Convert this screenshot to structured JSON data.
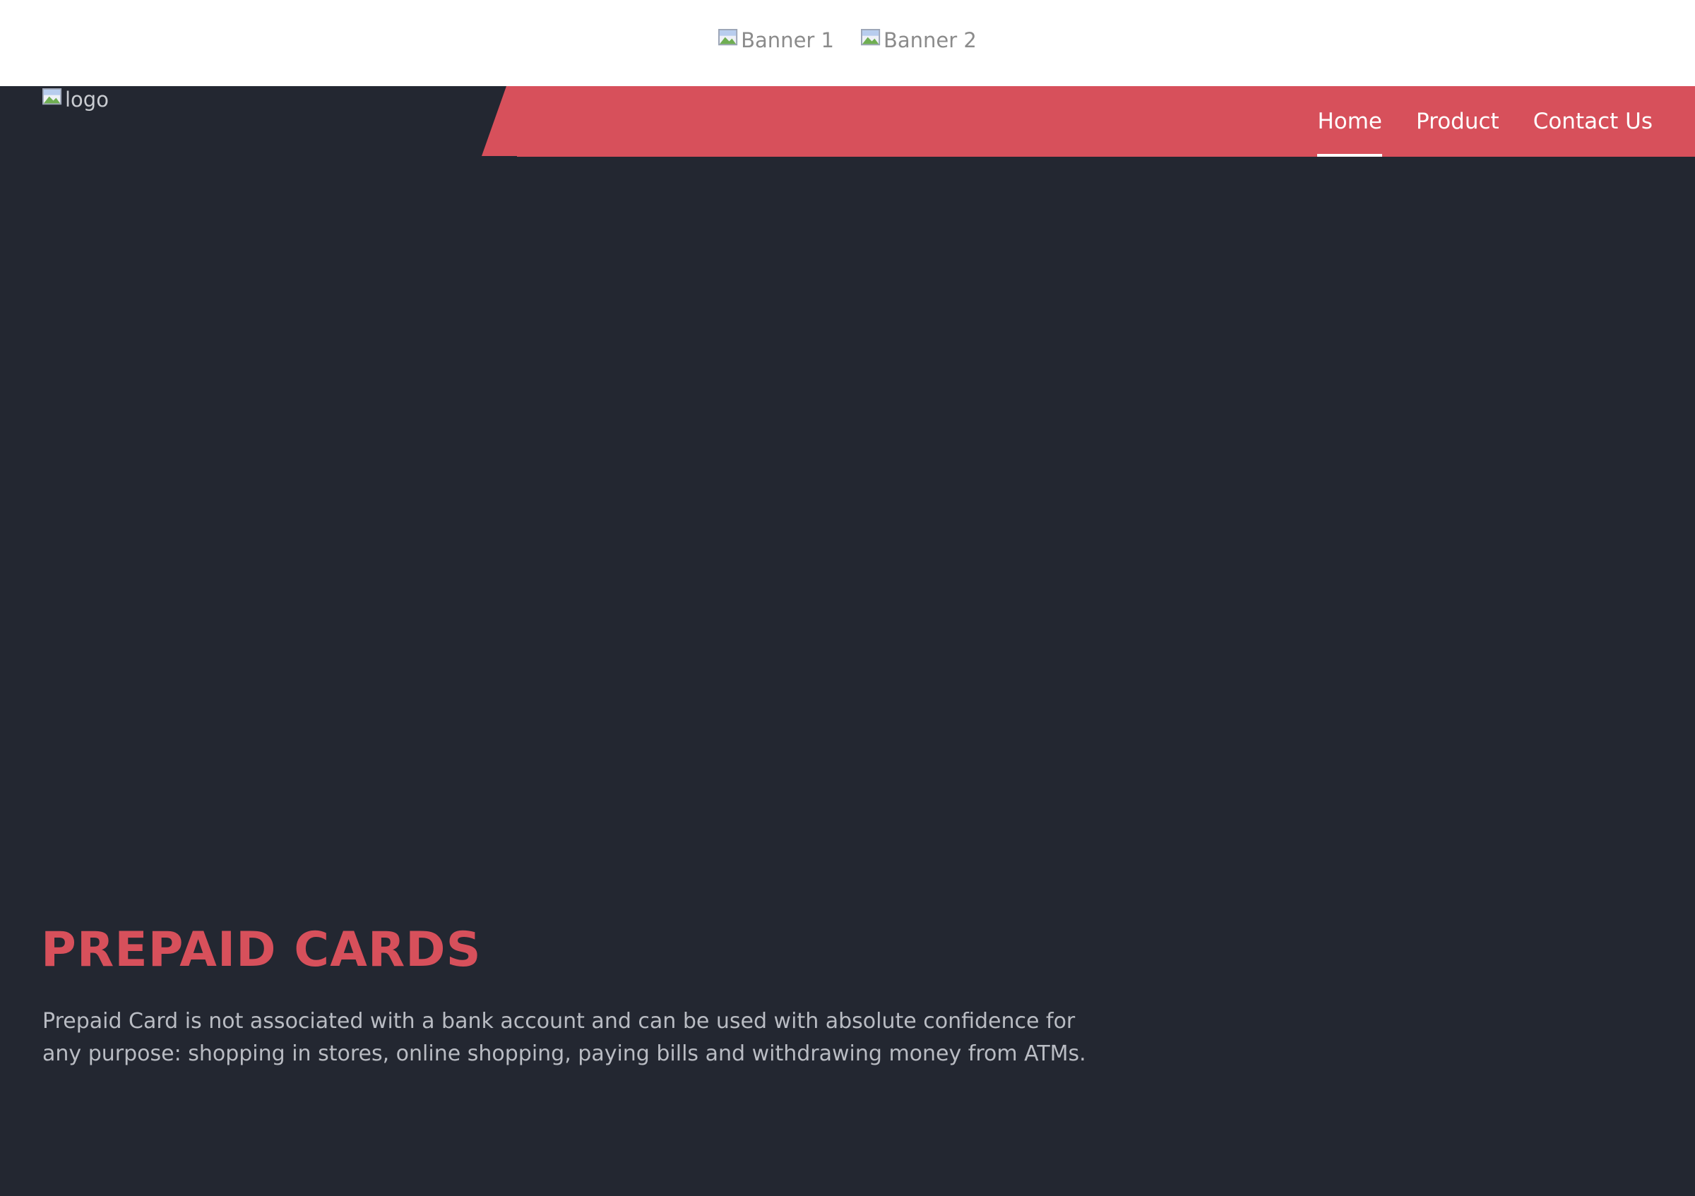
{
  "colors": {
    "background": "#232731",
    "accent": "#d7505b",
    "banner_bg": "#ffffff",
    "nav_text": "#ffffff",
    "body_text": "#b9bcc3"
  },
  "banners": [
    {
      "alt": "Banner 1",
      "icon": "broken-image-icon"
    },
    {
      "alt": "Banner 2",
      "icon": "broken-image-icon"
    }
  ],
  "header": {
    "logo_alt": "logo",
    "logo_icon": "broken-image-icon",
    "nav": [
      {
        "label": "Home",
        "active": true
      },
      {
        "label": "Product",
        "active": false
      },
      {
        "label": "Contact Us",
        "active": false
      }
    ]
  },
  "hero": {
    "title": "PREPAID CARDS",
    "description": "Prepaid Card is not associated with a bank account and can be used with absolute confidence for any purpose: shopping in stores, online shopping, paying bills and withdrawing money from ATMs."
  }
}
